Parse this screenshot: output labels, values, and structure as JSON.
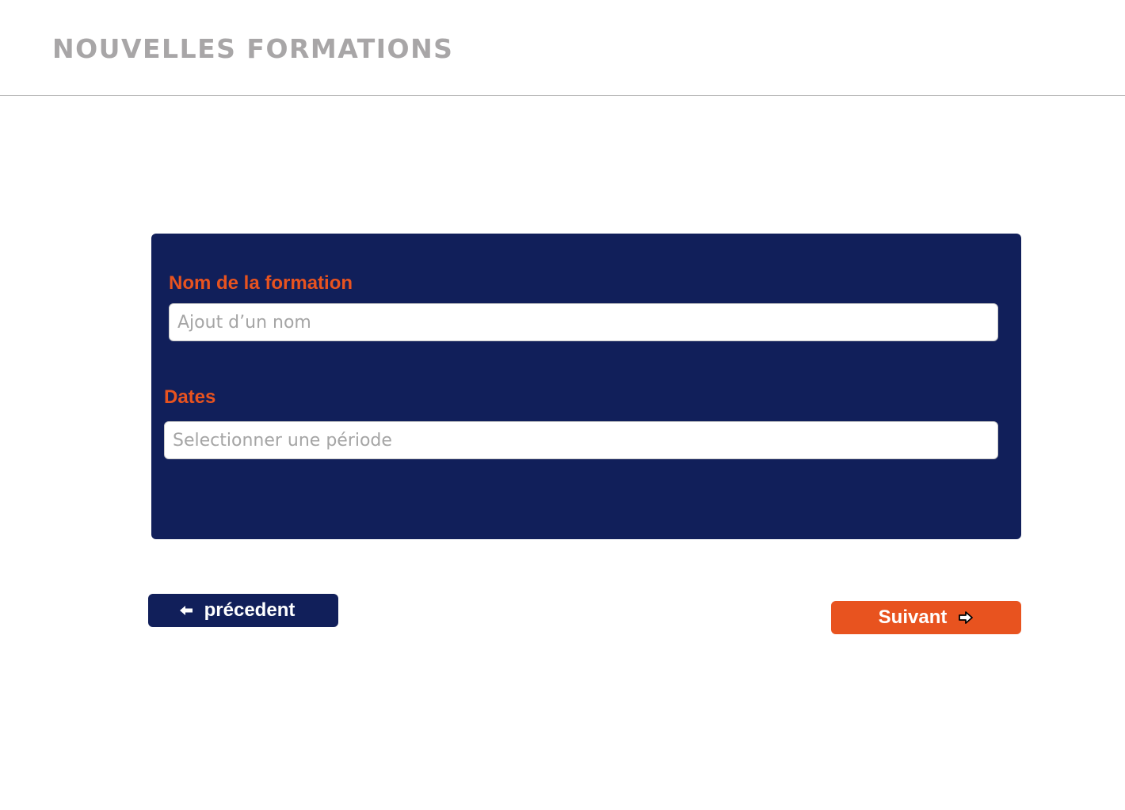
{
  "header": {
    "title": "NOUVELLES FORMATIONS"
  },
  "form": {
    "name_field": {
      "label": "Nom de la formation",
      "placeholder": "Ajout d’un nom",
      "value": ""
    },
    "dates_field": {
      "label": "Dates",
      "placeholder": "Selectionner une période",
      "value": ""
    }
  },
  "navigation": {
    "previous_label": "précedent",
    "previous_icon": "arrow-left-icon",
    "next_label": "Suivant",
    "next_icon": "arrow-right-icon"
  },
  "colors": {
    "navy": "#111f5a",
    "orange": "#e8531f",
    "title_gray": "#a8a6a7"
  }
}
